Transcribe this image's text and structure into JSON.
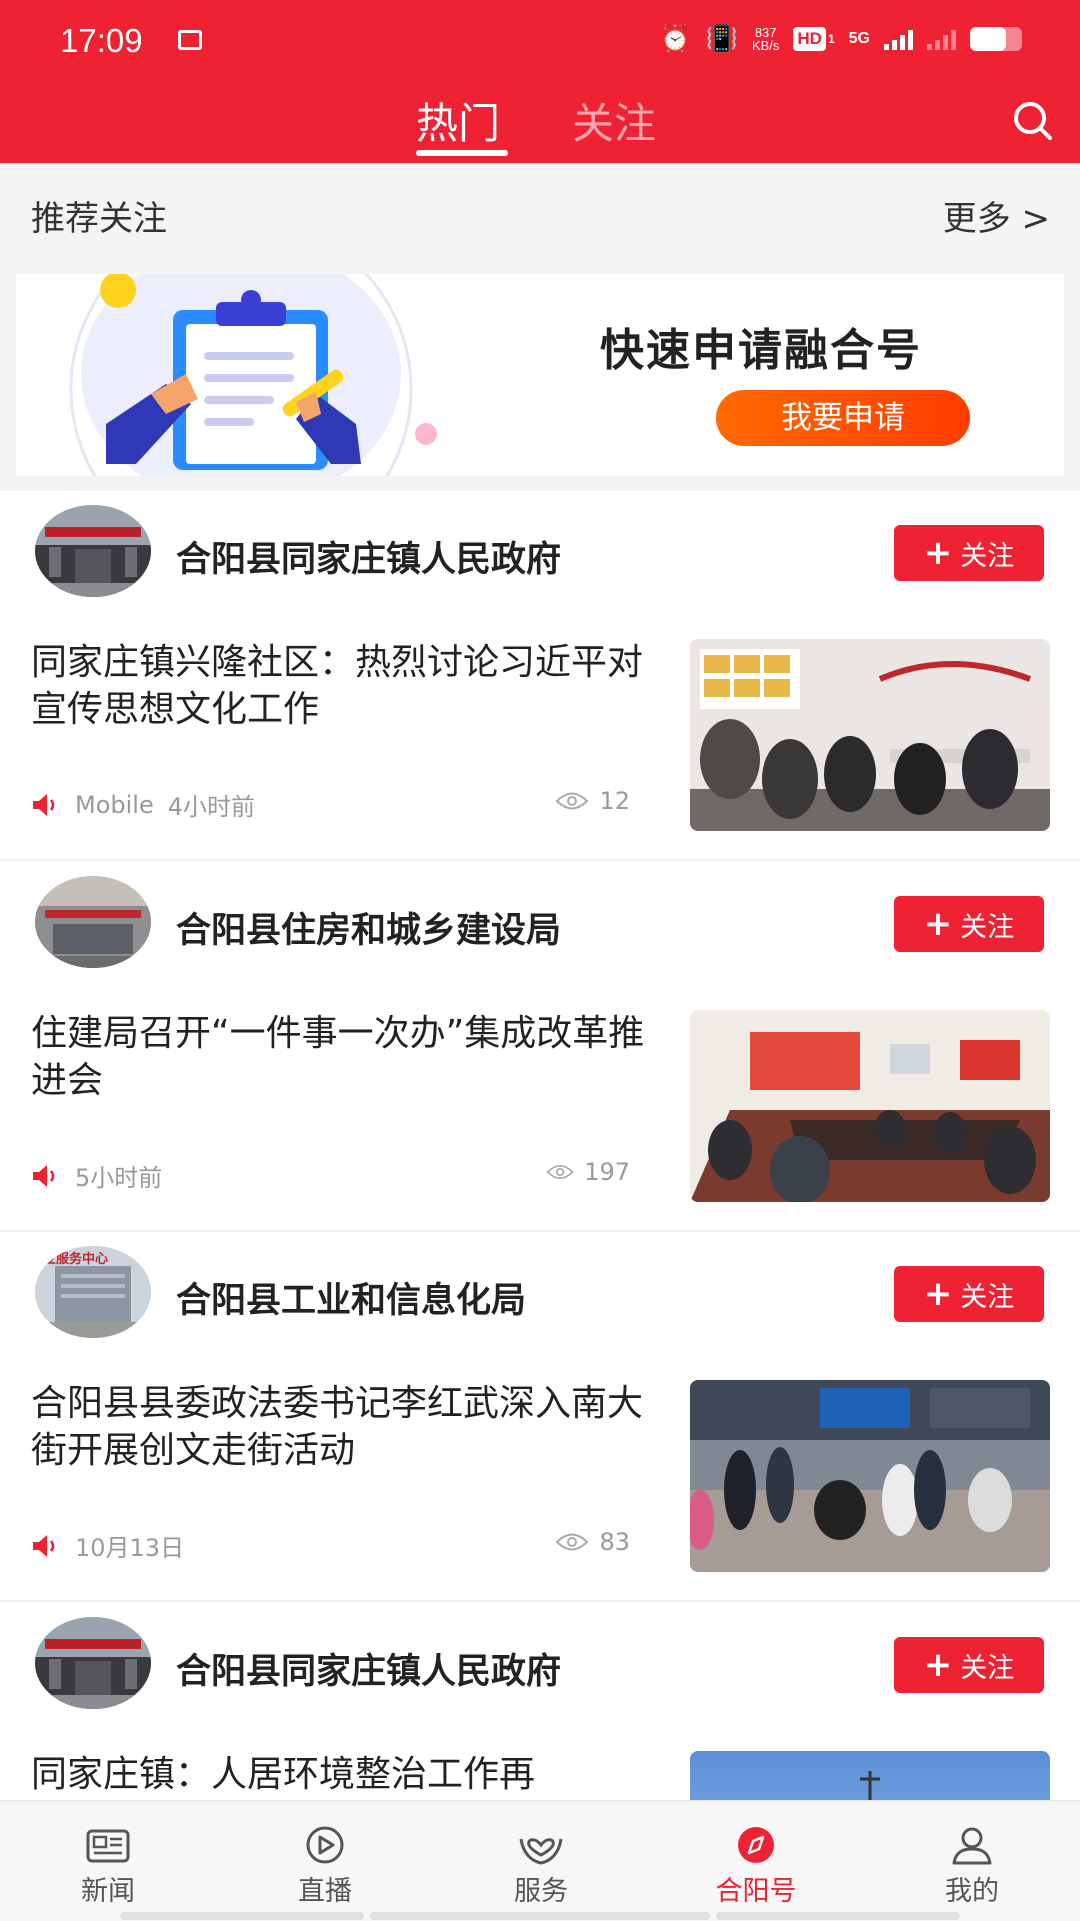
{
  "status_bar": {
    "time": "17:09",
    "net_speed_value": "837",
    "net_speed_unit": "KB/s",
    "hd_label": "HD",
    "sim_index": "1",
    "network_type": "5G",
    "battery_level": 0.7
  },
  "header": {
    "tabs": [
      {
        "label": "热门",
        "active": true
      },
      {
        "label": "关注",
        "active": false
      }
    ]
  },
  "recommend": {
    "title": "推荐关注",
    "more": "更多 >"
  },
  "banner": {
    "title": "快速申请融合号",
    "button": "我要申请"
  },
  "feed": [
    {
      "author": "合阳县同家庄镇人民政府",
      "follow": "关注",
      "headline": "同家庄镇兴隆社区：热烈讨论习近平对宣传思想文化工作",
      "source": "Mobile",
      "time": "4小时前",
      "views": "12"
    },
    {
      "author": "合阳县住房和城乡建设局",
      "follow": "关注",
      "headline": "住建局召开“一件事一次办”集成改革推进会",
      "source": "",
      "time": "5小时前",
      "views": "197"
    },
    {
      "author": "合阳县工业和信息化局",
      "follow": "关注",
      "headline": "合阳县县委政法委书记李红武深入南大街开展创文走街活动",
      "source": "",
      "time": "10月13日",
      "views": "83"
    },
    {
      "author": "合阳县同家庄镇人民政府",
      "follow": "关注",
      "headline": "同家庄镇：人居环境整治工作再",
      "source": "",
      "time": "",
      "views": ""
    }
  ],
  "avatar_caption": "业服务中心",
  "bottom_nav": [
    {
      "label": "新闻",
      "icon": "newspaper-icon",
      "active": false
    },
    {
      "label": "直播",
      "icon": "play-icon",
      "active": false
    },
    {
      "label": "服务",
      "icon": "heart-hands-icon",
      "active": false
    },
    {
      "label": "合阳号",
      "icon": "compass-icon",
      "active": true
    },
    {
      "label": "我的",
      "icon": "user-icon",
      "active": false
    }
  ],
  "colors": {
    "brand_red": "#ee2233",
    "banner_button": "#ff5500",
    "muted_text": "#999999"
  }
}
